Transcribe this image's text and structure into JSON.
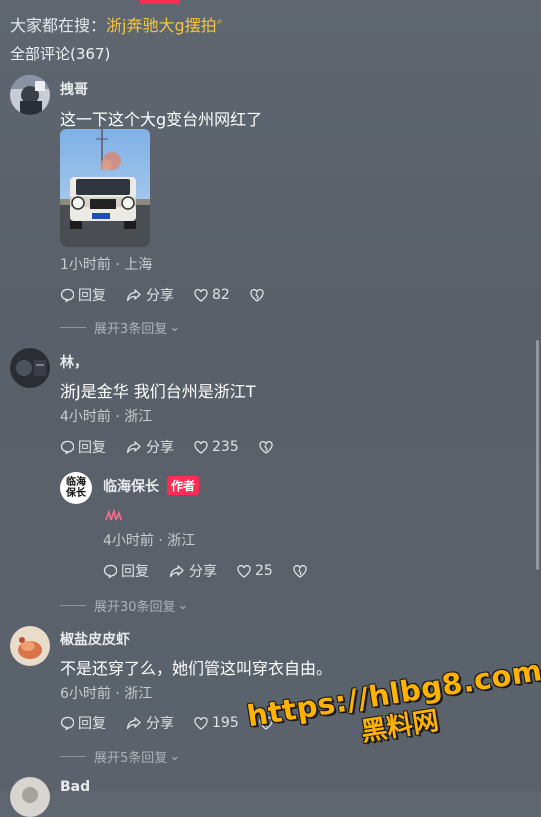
{
  "search": {
    "prefix": "大家都在搜：",
    "keyword": "浙j奔驰大g摆拍"
  },
  "comments_header": {
    "total_label": "全部评论(367)"
  },
  "comments": [
    {
      "username": "拽哥",
      "text": "这一下这个大g变台州网红了",
      "meta": "1小时前 · 上海",
      "reply_label": "回复",
      "share_label": "分享",
      "likes": "82",
      "expand": "展开3条回复"
    },
    {
      "username": "林，",
      "text": "浙J是金华 我们台州是浙江T",
      "meta": "4小时前 · 浙江",
      "reply_label": "回复",
      "share_label": "分享",
      "likes": "235",
      "reply": {
        "username": "临海保长",
        "avatar_text": "临海保长",
        "author_tag": "作者",
        "meta": "4小时前 · 浙江",
        "reply_label": "回复",
        "share_label": "分享",
        "likes": "25"
      },
      "expand": "展开30条回复"
    },
    {
      "username": "椒盐皮皮虾",
      "text": "不是还穿了么，她们管这叫穿衣自由。",
      "meta": "6小时前 · 浙江",
      "reply_label": "回复",
      "share_label": "分享",
      "likes": "195",
      "expand": "展开5条回复"
    },
    {
      "username": "Bad"
    }
  ],
  "watermark": {
    "url": "https://hlbg8.com",
    "text": "黑料网"
  },
  "colors": {
    "keyword": "#f5c542",
    "author_tag": "#fe2c55",
    "watermark": "#ffb300"
  }
}
